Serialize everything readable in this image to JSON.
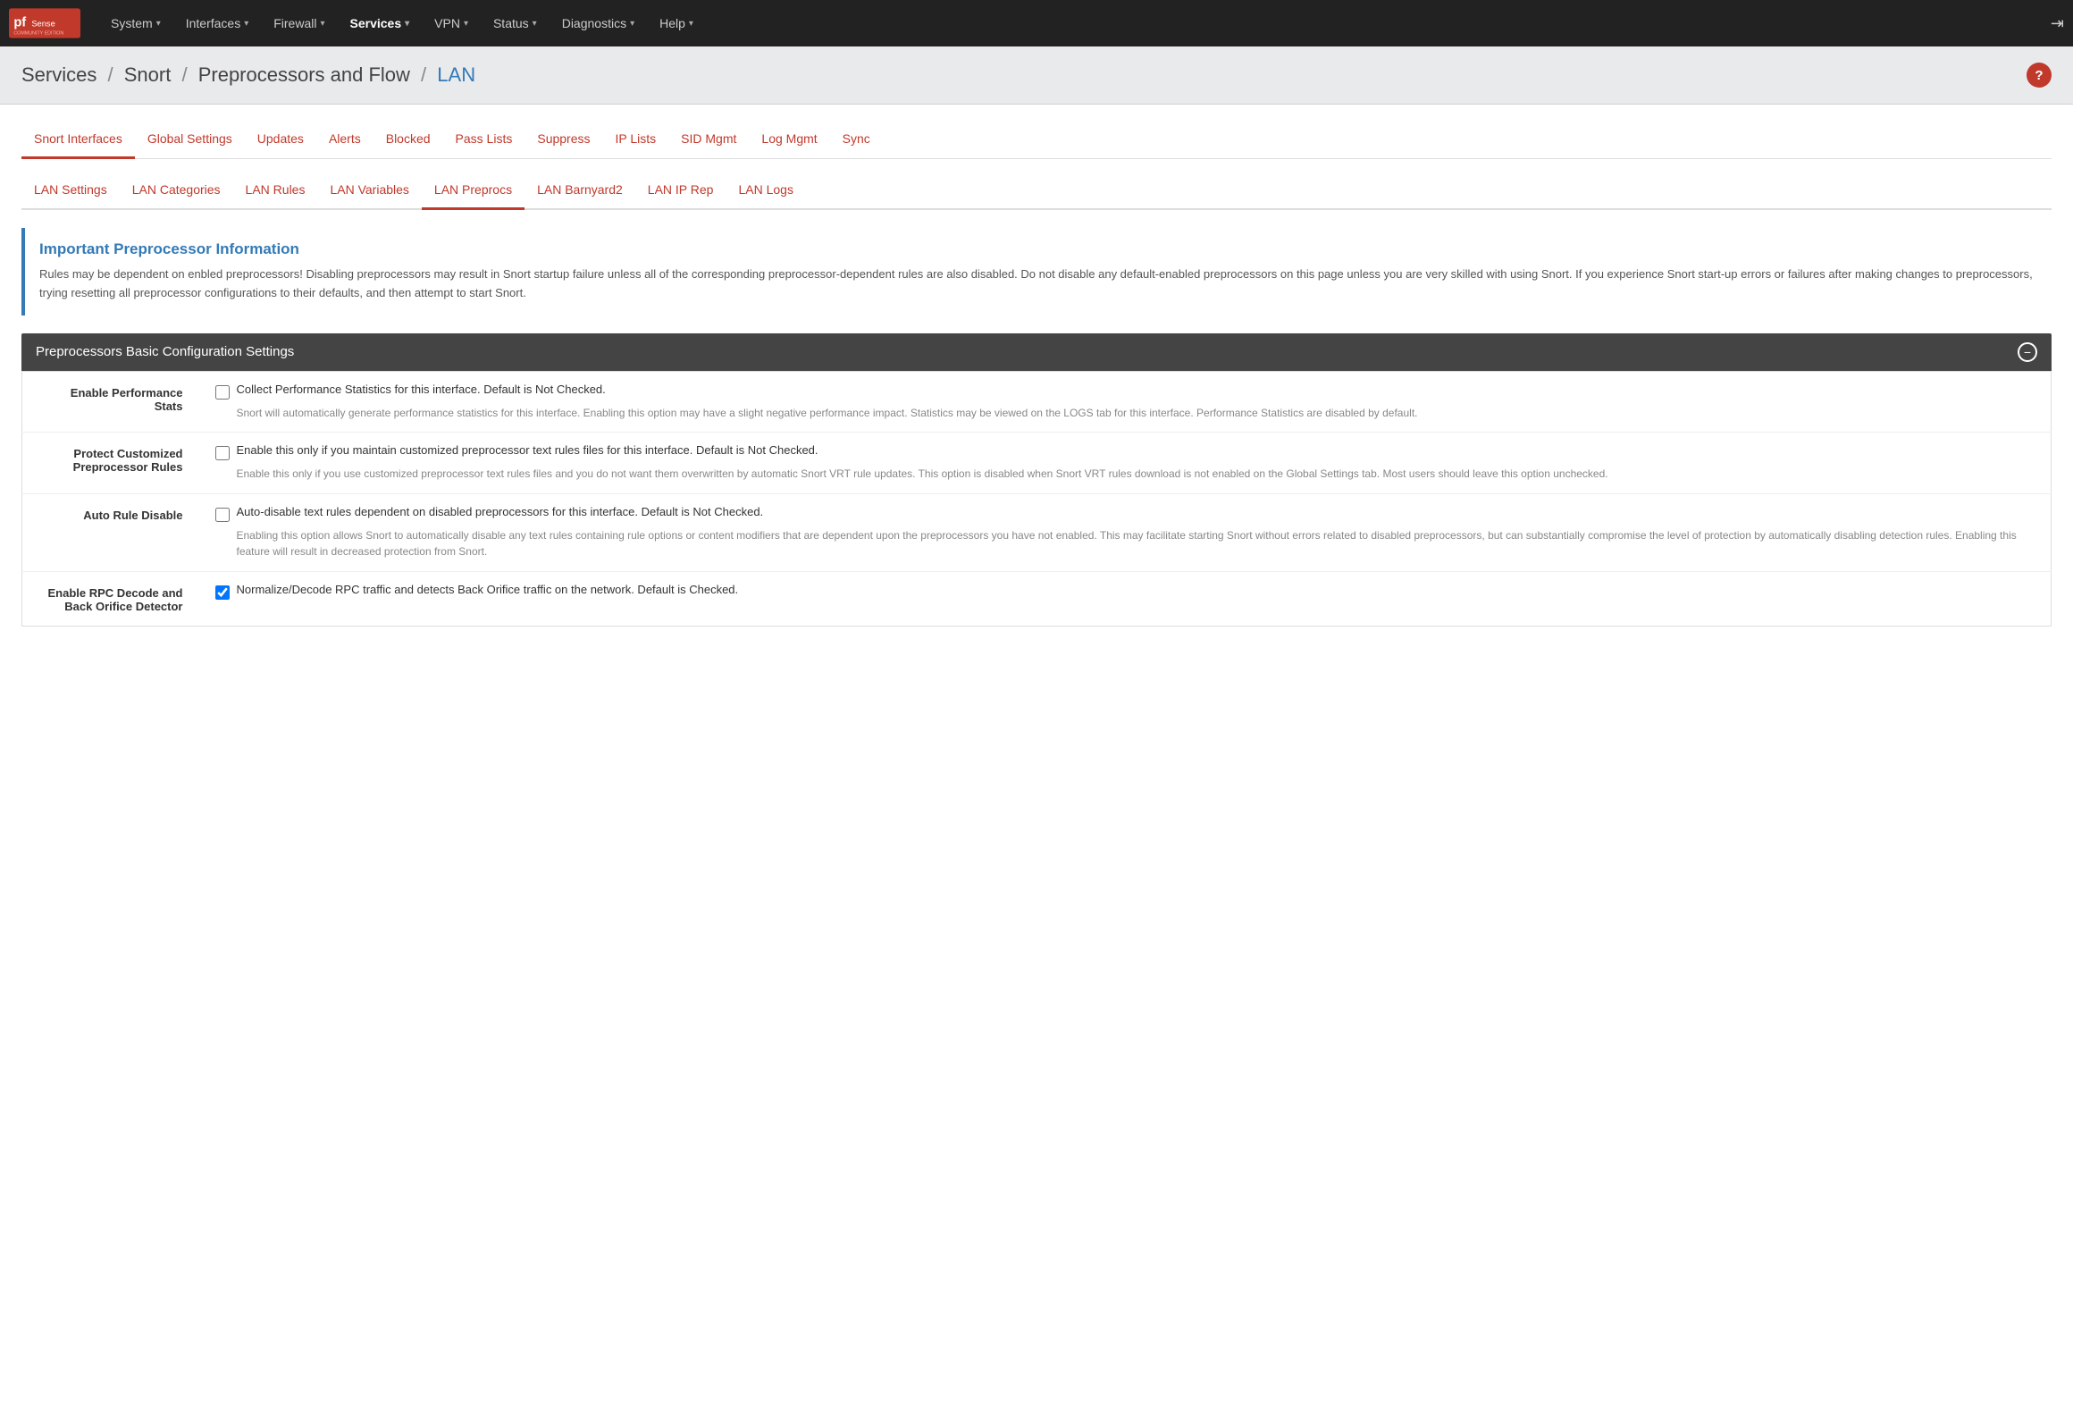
{
  "nav": {
    "brand": "pfSense",
    "items": [
      {
        "label": "System",
        "id": "system",
        "arrow": true
      },
      {
        "label": "Interfaces",
        "id": "interfaces",
        "arrow": true
      },
      {
        "label": "Firewall",
        "id": "firewall",
        "arrow": true
      },
      {
        "label": "Services",
        "id": "services",
        "arrow": true,
        "active": true
      },
      {
        "label": "VPN",
        "id": "vpn",
        "arrow": true
      },
      {
        "label": "Status",
        "id": "status",
        "arrow": true
      },
      {
        "label": "Diagnostics",
        "id": "diagnostics",
        "arrow": true
      },
      {
        "label": "Help",
        "id": "help",
        "arrow": true
      }
    ]
  },
  "breadcrumb": {
    "parts": [
      "Services",
      "Snort",
      "Preprocessors and Flow",
      "LAN"
    ],
    "help_label": "?"
  },
  "tabs1": [
    {
      "label": "Snort Interfaces",
      "id": "snort-interfaces",
      "active": true
    },
    {
      "label": "Global Settings",
      "id": "global-settings"
    },
    {
      "label": "Updates",
      "id": "updates"
    },
    {
      "label": "Alerts",
      "id": "alerts"
    },
    {
      "label": "Blocked",
      "id": "blocked"
    },
    {
      "label": "Pass Lists",
      "id": "pass-lists"
    },
    {
      "label": "Suppress",
      "id": "suppress"
    },
    {
      "label": "IP Lists",
      "id": "ip-lists"
    },
    {
      "label": "SID Mgmt",
      "id": "sid-mgmt"
    },
    {
      "label": "Log Mgmt",
      "id": "log-mgmt"
    },
    {
      "label": "Sync",
      "id": "sync"
    }
  ],
  "tabs2": [
    {
      "label": "LAN Settings",
      "id": "lan-settings"
    },
    {
      "label": "LAN Categories",
      "id": "lan-categories"
    },
    {
      "label": "LAN Rules",
      "id": "lan-rules"
    },
    {
      "label": "LAN Variables",
      "id": "lan-variables"
    },
    {
      "label": "LAN Preprocs",
      "id": "lan-preprocs",
      "active": true
    },
    {
      "label": "LAN Barnyard2",
      "id": "lan-barnyard2"
    },
    {
      "label": "LAN IP Rep",
      "id": "lan-ip-rep"
    },
    {
      "label": "LAN Logs",
      "id": "lan-logs"
    }
  ],
  "info_box": {
    "title": "Important Preprocessor Information",
    "text": "Rules may be dependent on enbled preprocessors! Disabling preprocessors may result in Snort startup failure unless all of the corresponding preprocessor-dependent rules are also disabled. Do not disable any default-enabled preprocessors on this page unless you are very skilled with using Snort. If you experience Snort start-up errors or failures after making changes to preprocessors, trying resetting all preprocessor configurations to their defaults, and then attempt to start Snort."
  },
  "section": {
    "title": "Preprocessors Basic Configuration Settings",
    "collapse_label": "−"
  },
  "rows": [
    {
      "id": "enable-perf-stats",
      "label": "Enable Performance\nStats",
      "checked": false,
      "main_text": "Collect Performance Statistics for this interface. Default is Not Checked.",
      "desc_text": "Snort will automatically generate performance statistics for this interface. Enabling this option may have a slight negative performance impact. Statistics may be viewed on the LOGS tab for this interface. Performance Statistics are disabled by default."
    },
    {
      "id": "protect-customized",
      "label": "Protect Customized\nPreprocessor Rules",
      "checked": false,
      "main_text": "Enable this only if you maintain customized preprocessor text rules files for this interface. Default is Not Checked.",
      "desc_text": "Enable this only if you use customized preprocessor text rules files and you do not want them overwritten by automatic Snort VRT rule updates. This option is disabled when Snort VRT rules download is not enabled on the Global Settings tab. Most users should leave this option unchecked."
    },
    {
      "id": "auto-rule-disable",
      "label": "Auto Rule Disable",
      "checked": false,
      "main_text": "Auto-disable text rules dependent on disabled preprocessors for this interface. Default is Not Checked.",
      "desc_text": "Enabling this option allows Snort to automatically disable any text rules containing rule options or content modifiers that are dependent upon the preprocessors you have not enabled. This may facilitate starting Snort without errors related to disabled preprocessors, but can substantially compromise the level of protection by automatically disabling detection rules. Enabling this feature will result in decreased protection from Snort."
    },
    {
      "id": "rpc-decode",
      "label": "Enable RPC Decode and\nBack Orifice Detector",
      "checked": true,
      "main_text": "Normalize/Decode RPC traffic and detects Back Orifice traffic on the network. Default is Checked.",
      "desc_text": ""
    }
  ]
}
